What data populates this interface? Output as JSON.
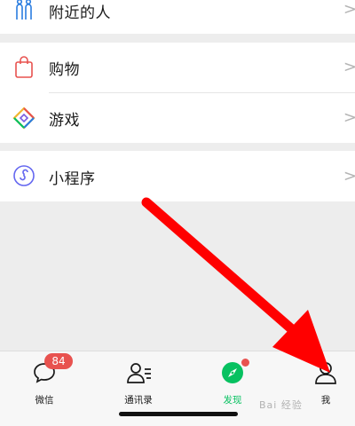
{
  "menu": {
    "nearby": {
      "label": "附近的人",
      "icon": "people-nearby-icon"
    },
    "shopping": {
      "label": "购物",
      "icon": "shopping-bag-icon"
    },
    "games": {
      "label": "游戏",
      "icon": "game-diamond-icon"
    },
    "mini_programs": {
      "label": "小程序",
      "icon": "mini-program-icon"
    },
    "chevron": ">"
  },
  "tabbar": {
    "chats": {
      "label": "微信",
      "badge": "84",
      "icon": "chat-bubble-icon"
    },
    "contacts": {
      "label": "通讯录",
      "icon": "contacts-icon"
    },
    "discover": {
      "label": "发现",
      "icon": "compass-icon",
      "active": true
    },
    "me": {
      "label": "我",
      "icon": "person-icon"
    }
  },
  "colors": {
    "accent": "#07c160",
    "badge": "#e8524f",
    "arrow": "#ff0000"
  },
  "watermark": "Bai 经验"
}
